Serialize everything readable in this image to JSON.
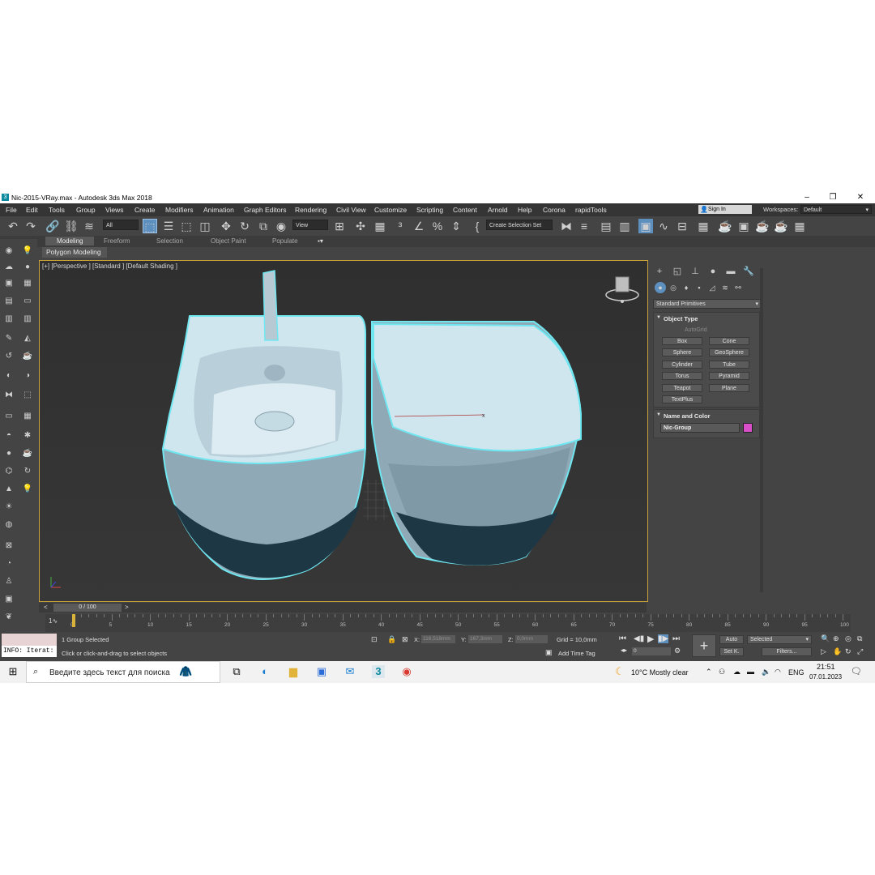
{
  "window": {
    "title": "Nic-2015-VRay.max - Autodesk 3ds Max 2018",
    "app_icon": "3"
  },
  "menu": [
    "File",
    "Edit",
    "Tools",
    "Group",
    "Views",
    "Create",
    "Modifiers",
    "Animation",
    "Graph Editors",
    "Rendering",
    "Civil View",
    "Customize",
    "Scripting",
    "Content",
    "Arnold",
    "Help",
    "Corona",
    "rapidTools"
  ],
  "account": {
    "sign_in": "Sign In",
    "workspaces_label": "Workspaces:",
    "workspace": "Default"
  },
  "toolbar": {
    "filter": "All",
    "ref_coord": "View",
    "selection_set": "Create Selection Set"
  },
  "ribbon": {
    "tabs": [
      "Modeling",
      "Freeform",
      "Selection",
      "Object Paint",
      "Populate"
    ],
    "active": "Modeling",
    "sub": "Polygon Modeling"
  },
  "viewport": {
    "label": "[+] [Perspective ] [Standard ] [Default Shading ]"
  },
  "command_panel": {
    "category": "Standard Primitives",
    "object_type": {
      "title": "Object Type",
      "autogrid": "AutoGrid",
      "buttons": [
        "Box",
        "Cone",
        "Sphere",
        "GeoSphere",
        "Cylinder",
        "Tube",
        "Torus",
        "Pyramid",
        "Teapot",
        "Plane",
        "TextPlus"
      ]
    },
    "name_color": {
      "title": "Name and Color",
      "name": "Nic-Group",
      "color": "#d94fc9"
    }
  },
  "timeline": {
    "frame": "0 / 100",
    "ticks": [
      "0",
      "5",
      "10",
      "15",
      "20",
      "25",
      "30",
      "35",
      "40",
      "45",
      "50",
      "55",
      "60",
      "65",
      "70",
      "75",
      "80",
      "85",
      "90",
      "95",
      "100"
    ]
  },
  "status": {
    "info": "INFO: Iterat:",
    "selected": "1 Group Selected",
    "prompt": "Click or click-and-drag to select objects",
    "x_label": "X:",
    "x": "116,518mm",
    "y_label": "Y:",
    "y": "167,3mm",
    "z_label": "Z:",
    "z": "0,0mm",
    "grid": "Grid = 10,0mm",
    "add_time_tag": "Add Time Tag",
    "auto": "Auto",
    "selected_mode": "Selected",
    "set_key": "Set K.",
    "filters": "Filters...",
    "frame_field": "0"
  },
  "taskbar": {
    "search_placeholder": "Введите здесь текст для поиска",
    "weather": "10°C  Mostly clear",
    "lang": "ENG",
    "time": "21:51",
    "date": "07.01.2023"
  }
}
